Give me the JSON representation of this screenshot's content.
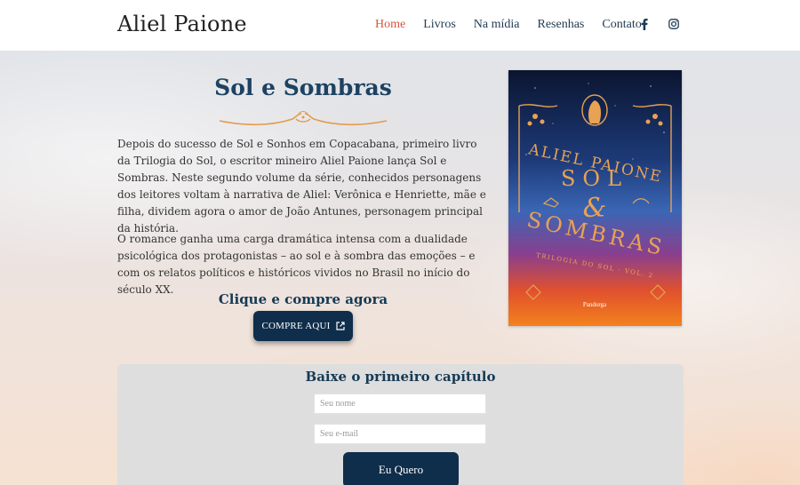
{
  "header": {
    "brand": "Aliel Paione",
    "nav": [
      "Home",
      "Livros",
      "Na mídia",
      "Resenhas",
      "Contato"
    ],
    "active_nav": "Home",
    "social_icons": [
      "facebook-icon",
      "instagram-icon"
    ]
  },
  "book": {
    "title": "Sol e Sombras",
    "paragraphs": [
      "Depois do sucesso de Sol e Sonhos em Copacabana, primeiro livro da Trilogia do Sol, o escritor mineiro Aliel Paione lança Sol e Sombras. Neste segundo volume da série, conhecidos personagens dos leitores voltam à narrativa de Aliel: Verônica e Henriette, mãe e filha, dividem agora o amor de João Antunes, personagem principal da história.",
      "O romance ganha uma carga dramática intensa com a dualidade psicológica dos protagonistas – ao sol e à sombra das emoções – e com os relatos políticos e históricos vividos no Brasil no início do século XX."
    ],
    "cta_heading": "Clique e compre agora",
    "buy_button": "COMPRE AQUI",
    "cover": {
      "author": "ALIEL PAIONE",
      "title_line1": "SOL",
      "title_amp": "&",
      "title_line2": "SOMBRAS",
      "series": "TRILOGIA DO SOL · VOL. 2",
      "publisher": "Pandorga"
    }
  },
  "download": {
    "title": "Baixe o primeiro capítulo",
    "name_placeholder": "Seu nome",
    "email_placeholder": "Seu e-mail",
    "submit_label": "Eu Quero"
  },
  "colors": {
    "accent": "#d9553f",
    "navy": "#0f2e4b",
    "heading": "#1d4262",
    "gold": "#e39a4a"
  }
}
